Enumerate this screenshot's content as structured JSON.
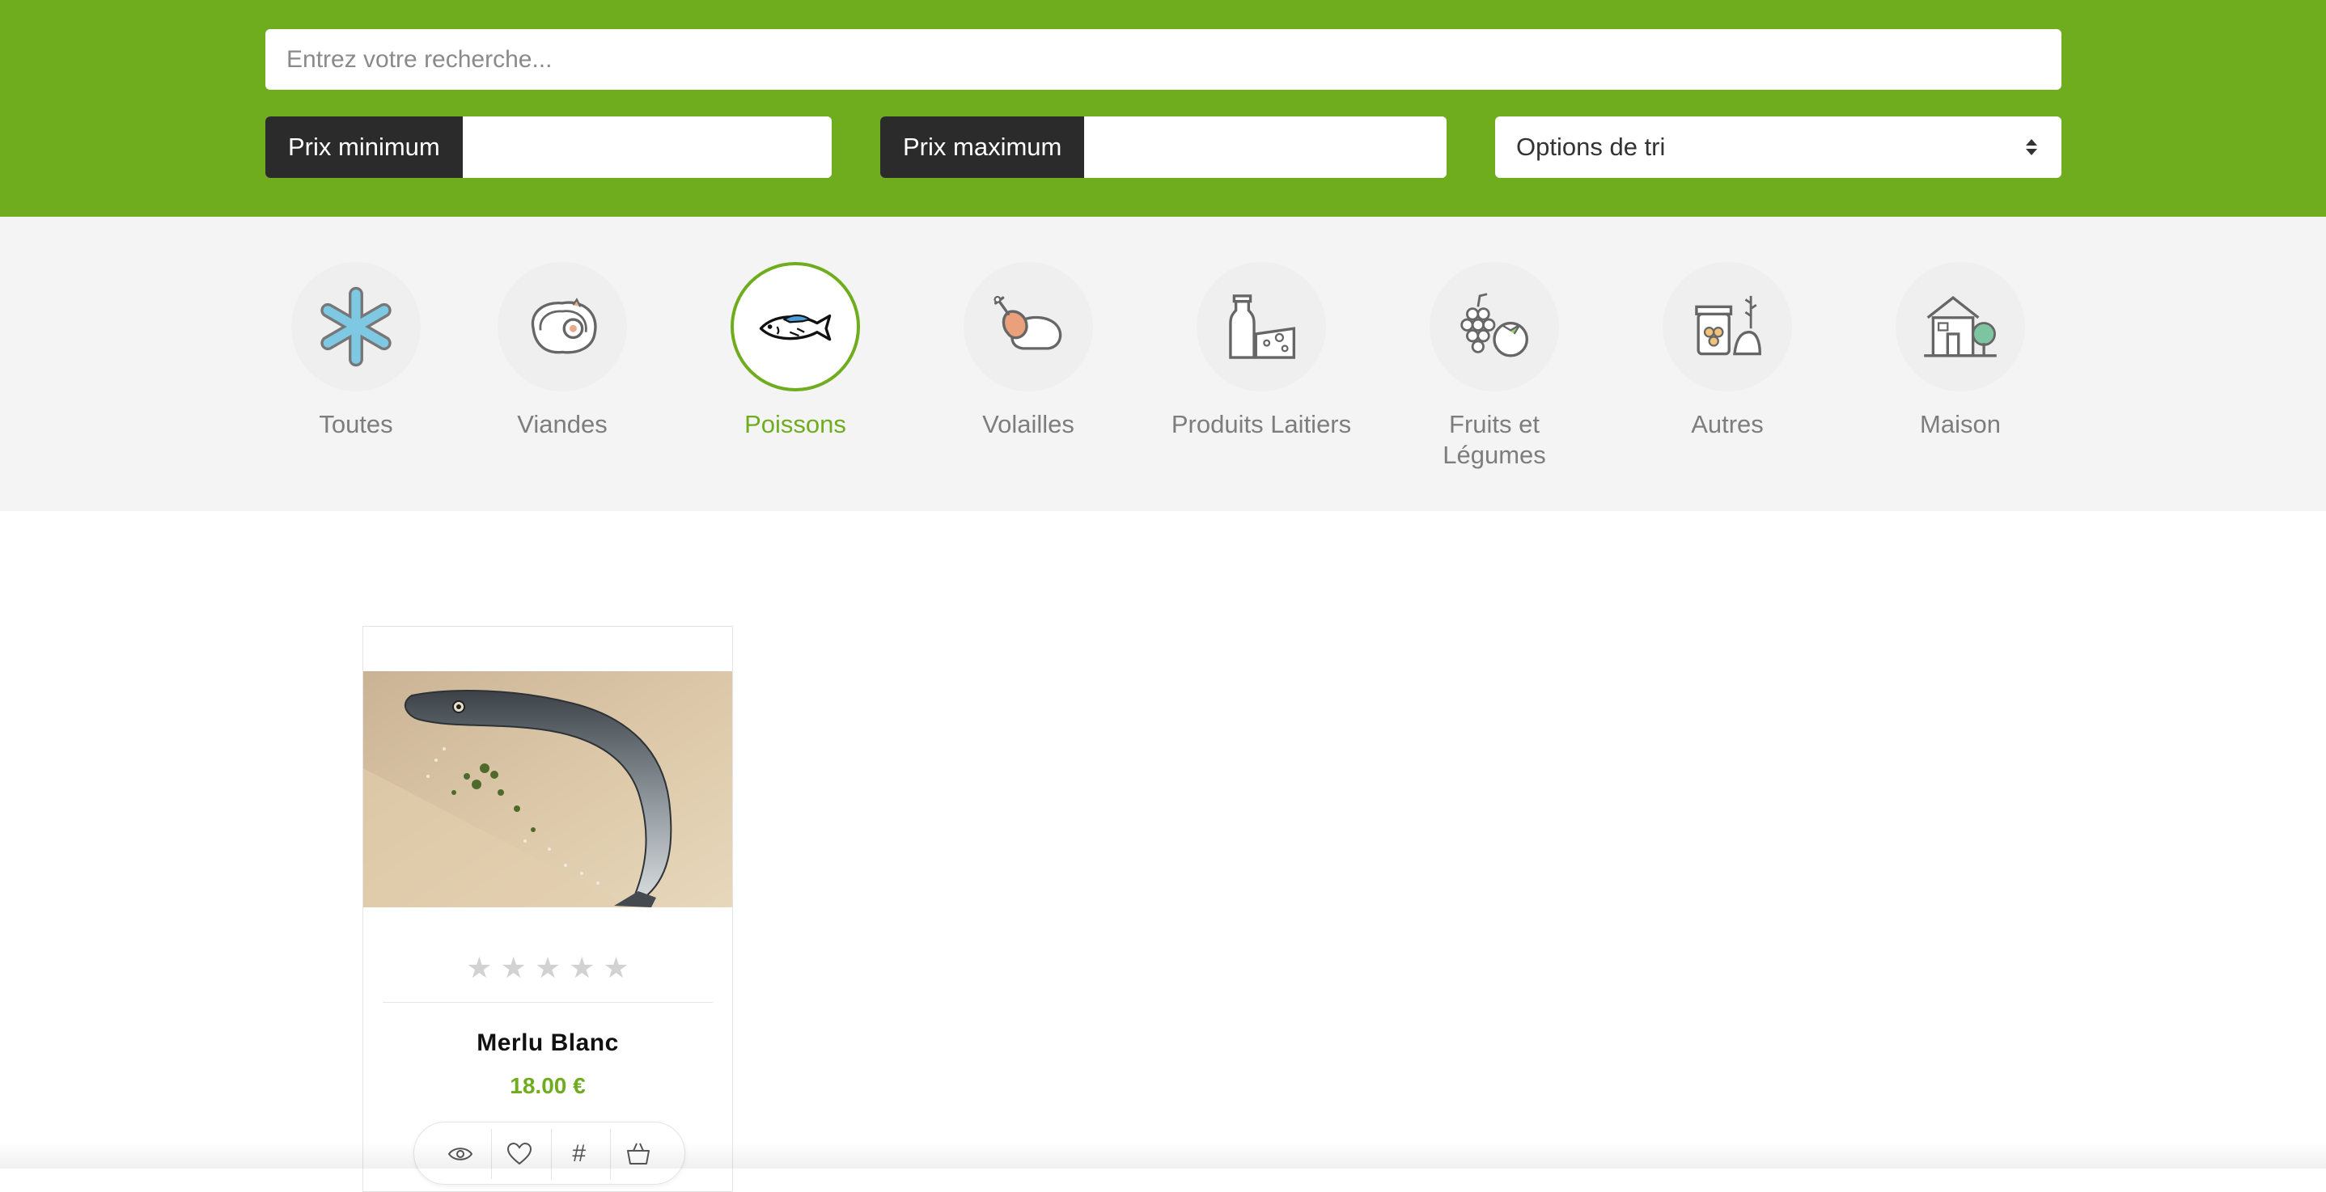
{
  "search": {
    "placeholder": "Entrez votre recherche..."
  },
  "filters": {
    "min_price_label": "Prix minimum",
    "max_price_label": "Prix maximum",
    "min_price_value": "",
    "max_price_value": "",
    "sort_label": "Options de tri"
  },
  "colors": {
    "brand_green": "#6fad1e",
    "dark_label": "#2b2b2b",
    "category_band": "#f4f4f4"
  },
  "categories": [
    {
      "label": "Toutes",
      "icon": "snowflake-icon",
      "active": false
    },
    {
      "label": "Viandes",
      "icon": "steak-icon",
      "active": false
    },
    {
      "label": "Poissons",
      "icon": "fish-icon",
      "active": true
    },
    {
      "label": "Volailles",
      "icon": "chicken-icon",
      "active": false
    },
    {
      "label": "Produits Laitiers",
      "icon": "milk-cheese-icon",
      "active": false
    },
    {
      "label": "Fruits et Légumes",
      "icon": "grapes-tomato-icon",
      "active": false
    },
    {
      "label": "Autres",
      "icon": "jars-icon",
      "active": false
    },
    {
      "label": "Maison",
      "icon": "house-icon",
      "active": false
    }
  ],
  "products": [
    {
      "name": "Merlu Blanc",
      "price": "18.00 €",
      "rating": 0,
      "rating_max": 5,
      "image": "whole-hake-fish-on-board",
      "actions": [
        "eye-icon",
        "heart-icon",
        "hash-icon",
        "basket-icon"
      ],
      "compare_symbol": "#"
    }
  ]
}
